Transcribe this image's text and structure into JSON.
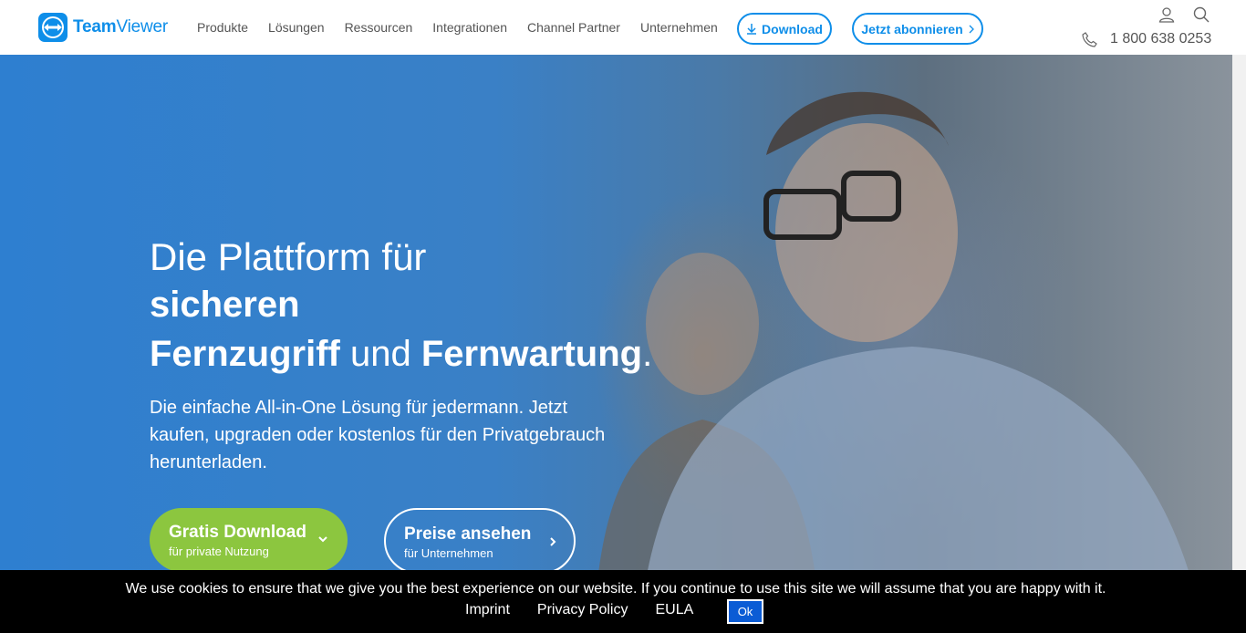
{
  "header": {
    "logo_text_bold": "Team",
    "logo_text_light": "Viewer",
    "nav": [
      "Produkte",
      "Lösungen",
      "Ressourcen",
      "Integrationen",
      "Channel Partner",
      "Unternehmen"
    ],
    "download_label": "Download",
    "subscribe_label": "Jetzt abonnieren",
    "phone": "1 800 638 0253"
  },
  "hero": {
    "line1": "Die Plattform für",
    "line2": "sicheren",
    "line3_bold1": "Fernzugriff",
    "line3_mid": " und ",
    "line3_bold2": "Fernwartung",
    "line3_end": ".",
    "subtitle": "Die einfache All-in-One Lösung für jedermann. Jetzt kaufen, upgraden oder kostenlos für den Privatgebrauch herunterladen.",
    "cta_primary_title": "Gratis Download",
    "cta_primary_sub": "für private Nutzung",
    "cta_secondary_title": "Preise ansehen",
    "cta_secondary_sub": "für Unternehmen"
  },
  "cookie": {
    "message": "We use cookies to ensure that we give you the best experience on our website. If you continue to use this site we will assume that you are happy with it.",
    "links": [
      "Imprint",
      "Privacy Policy",
      "EULA"
    ],
    "ok_label": "Ok"
  },
  "colors": {
    "brand_blue": "#0e8ee9",
    "cta_green": "#8cc63f",
    "cookie_bg": "#000000"
  }
}
